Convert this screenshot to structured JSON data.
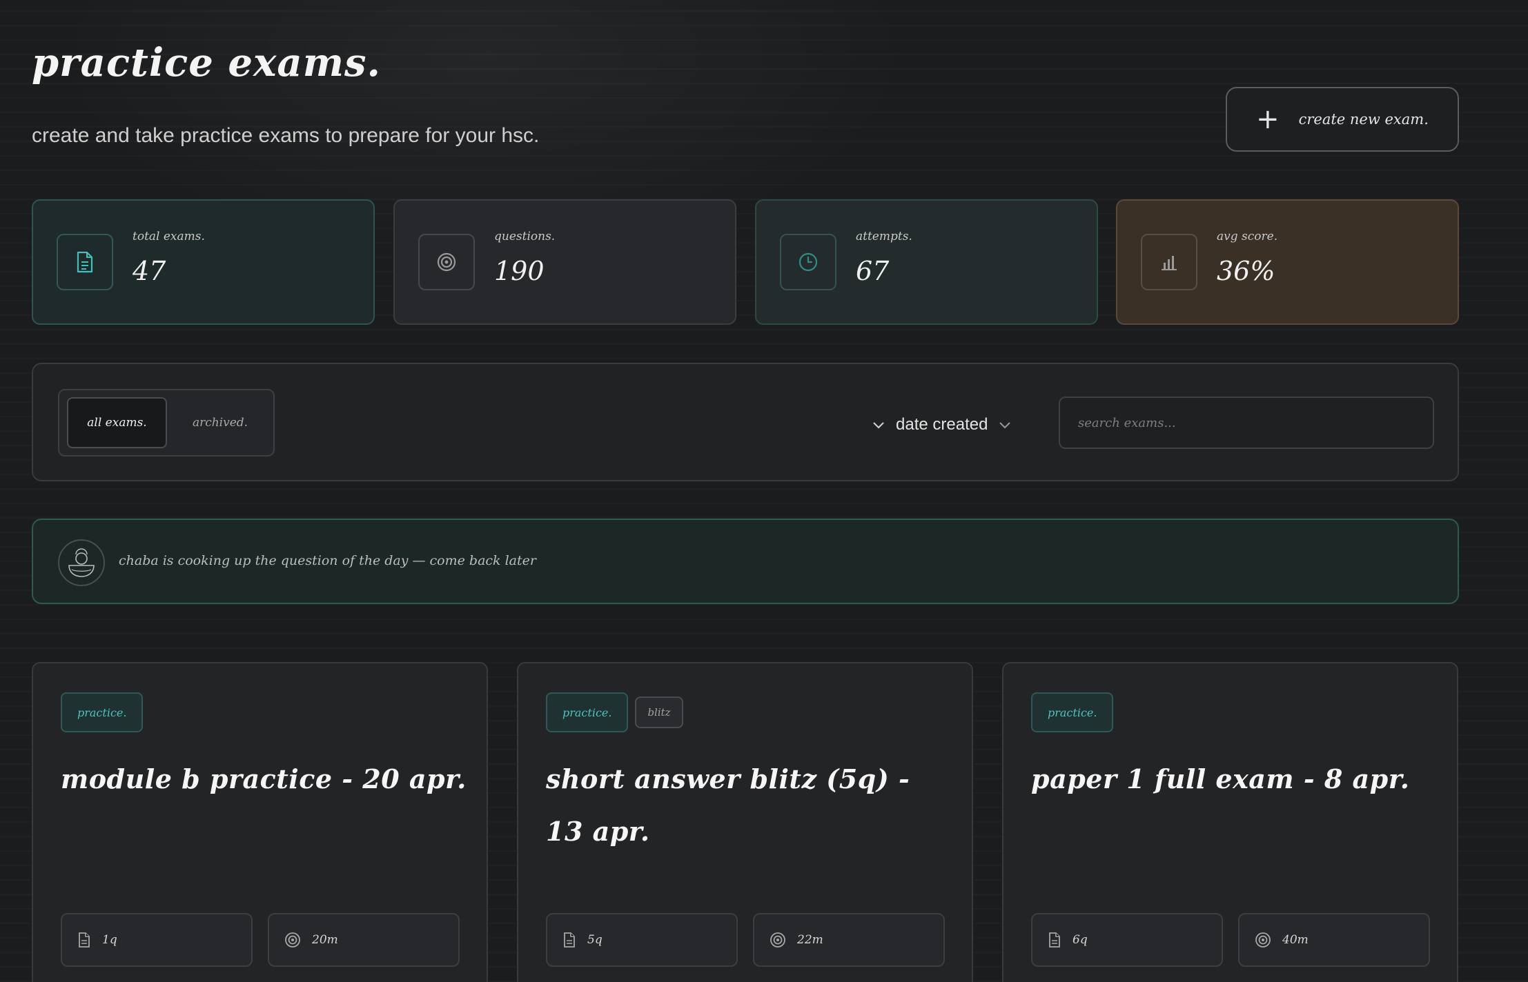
{
  "header": {
    "title": "practice exams.",
    "subtitle": "create and take practice exams to prepare for your hsc.",
    "create_button": "create new exam."
  },
  "stats": [
    {
      "label": "total exams.",
      "value": "47",
      "icon": "document-icon"
    },
    {
      "label": "questions.",
      "value": "190",
      "icon": "target-icon"
    },
    {
      "label": "attempts.",
      "value": "67",
      "icon": "clock-icon"
    },
    {
      "label": "avg score.",
      "value": "36%",
      "icon": "bar-chart-icon"
    }
  ],
  "filters": {
    "tabs": [
      "all exams.",
      "archived."
    ],
    "active_tab": "all exams.",
    "sort_label": "date created",
    "search_placeholder": "search exams..."
  },
  "qotd": {
    "message": "chaba is cooking up the question of the day — come back later"
  },
  "exams": [
    {
      "badges": [
        "practice."
      ],
      "title": "module b practice - 20 apr.",
      "questions": "1q",
      "duration": "20m"
    },
    {
      "badges": [
        "practice.",
        "blitz"
      ],
      "title": "short answer blitz (5q) - 13 apr.",
      "questions": "5q",
      "duration": "22m"
    },
    {
      "badges": [
        "practice."
      ],
      "title": "paper 1 full exam - 8 apr.",
      "questions": "6q",
      "duration": "40m"
    }
  ],
  "colors": {
    "background": "#1b1c1e",
    "accent_teal": "#4fc3c0",
    "avg_score_card": "#3a3026"
  }
}
